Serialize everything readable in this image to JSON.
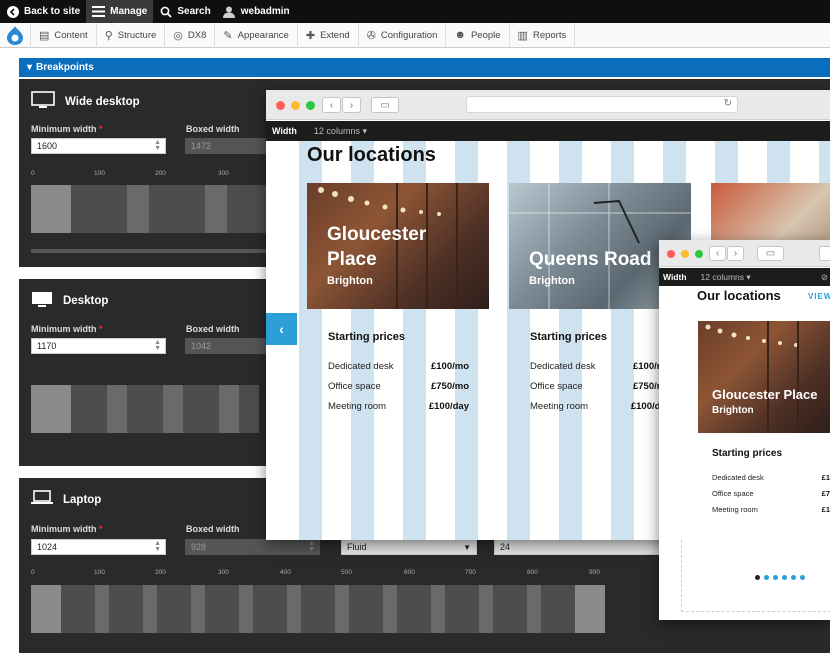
{
  "admin_bar": {
    "back": "Back to site",
    "manage": "Manage",
    "search": "Search",
    "user": "webadmin"
  },
  "toolbar": {
    "items": [
      "Content",
      "Structure",
      "DX8",
      "Appearance",
      "Extend",
      "Configuration",
      "People",
      "Reports"
    ]
  },
  "breakpoints": {
    "header": "Breakpoints",
    "min_label": "Minimum width",
    "boxed_label": "Boxed width",
    "panels": [
      {
        "name": "Wide desktop",
        "min": "1600",
        "boxed": "1472"
      },
      {
        "name": "Desktop",
        "min": "1170",
        "boxed": "1042"
      },
      {
        "name": "Laptop",
        "min": "1024",
        "boxed": "928",
        "layout": "Fluid",
        "columns": "24"
      }
    ],
    "ruler_ticks": [
      "0",
      "100",
      "200",
      "300",
      "400",
      "500",
      "600",
      "700",
      "800",
      "900"
    ]
  },
  "preview_large": {
    "width_label": "Width",
    "columns": "12 columns",
    "heading": "Our locations",
    "prev_arrow": "‹",
    "cards": [
      {
        "title_1": "Gloucester",
        "title_2": "Place",
        "subtitle": "Brighton"
      },
      {
        "title_1": "Queens Road",
        "title_2": "",
        "subtitle": "Brighton"
      }
    ],
    "starting_prices": "Starting prices",
    "prices": [
      {
        "label": "Dedicated desk",
        "value": "£100/mo"
      },
      {
        "label": "Office space",
        "value": "£750/mo"
      },
      {
        "label": "Meeting room",
        "value": "£100/day"
      }
    ]
  },
  "preview_small": {
    "width_label": "Width",
    "columns": "12 columns",
    "heading": "Our locations",
    "view_link": "VIEW",
    "card_title": "Gloucester Place",
    "card_subtitle": "Brighton",
    "starting_prices": "Starting prices",
    "prices": [
      {
        "label": "Dedicated desk",
        "value": "£1"
      },
      {
        "label": "Office space",
        "value": "£7"
      },
      {
        "label": "Meeting room",
        "value": "£1"
      }
    ]
  },
  "colors": {
    "accent": "#0a6ebd",
    "panel": "#2a2a2a",
    "stripe": "#cfe2f0",
    "arrow": "#2b9fd6"
  }
}
